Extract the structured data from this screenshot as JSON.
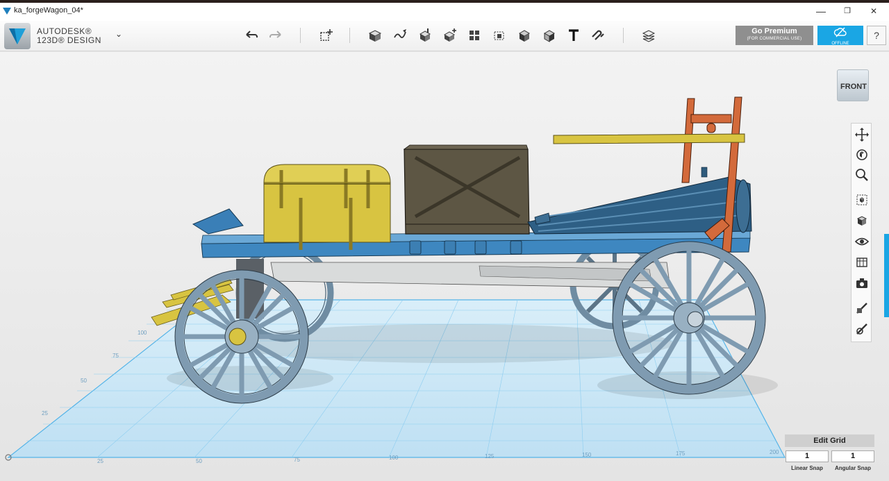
{
  "window": {
    "title": "ka_forgeWagon_04*",
    "minimize": "—",
    "maximize": "❐",
    "close": "✕"
  },
  "brand": {
    "line1": "AUTODESK®",
    "line2": "123D® DESIGN",
    "menu_chevron": "⌄"
  },
  "toolbar": {
    "tools": [
      "undo-icon",
      "redo-icon",
      "primitives-icon",
      "sketch-icon",
      "construct-icon",
      "modify-icon",
      "pattern-icon",
      "grouping-icon",
      "combine-icon",
      "measure-icon",
      "material-icon",
      "text-icon",
      "snap-icon",
      "layers-icon"
    ],
    "premium_label": "Go Premium",
    "premium_sub": "(FOR COMMERCIAL USE)",
    "offline_label": "OFFLINE",
    "help_label": "?"
  },
  "viewcube": {
    "face": "FRONT"
  },
  "navbar": {
    "tools": [
      "pan-icon",
      "orbit-icon",
      "zoom-icon",
      "fit-icon",
      "views-icon",
      "visibility-icon",
      "material-display-icon",
      "screenshot-icon",
      "edit-tool-icon",
      "edit-tool-2-icon"
    ]
  },
  "grid": {
    "edit_grid_label": "Edit Grid",
    "linear_snap_value": "1",
    "linear_snap_label": "Linear Snap",
    "angular_snap_value": "1",
    "angular_snap_label": "Angular Snap"
  },
  "axis_labels": {
    "bottom": [
      "25",
      "50",
      "75",
      "100",
      "125",
      "150",
      "175",
      "200"
    ],
    "left": [
      "100",
      "75",
      "50",
      "25"
    ]
  },
  "colors": {
    "accent": "#1aa6e4",
    "wagon_bed": "#3e87c0",
    "chest": "#d8c441",
    "crate": "#5d5644",
    "wheels": "#7f9bb1",
    "frame_post": "#d36a3b"
  }
}
